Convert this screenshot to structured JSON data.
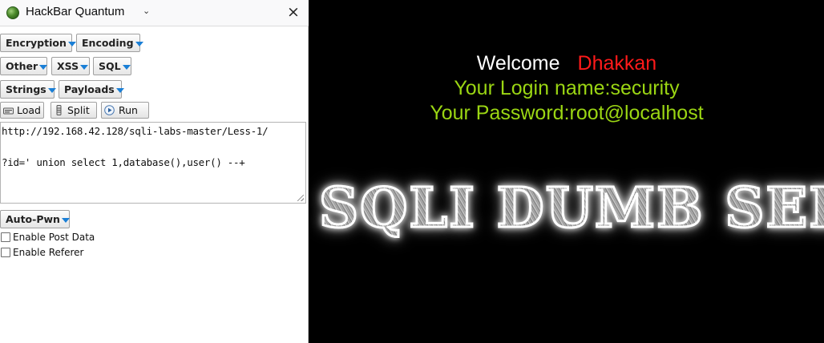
{
  "hackbar": {
    "title": "HackBar Quantum",
    "title_icon": "chevron-down-icon",
    "close": "×",
    "menus": {
      "encryption": "Encryption",
      "encoding": "Encoding",
      "other": "Other",
      "xss": "XSS",
      "sql": "SQL",
      "strings": "Strings",
      "payloads": "Payloads",
      "auto_pwn": "Auto-Pwn"
    },
    "toolbar": {
      "load": "Load",
      "split": "Split",
      "run": "Run"
    },
    "url_field": {
      "line1": "http://192.168.42.128/sqli-labs-master/Less-1/",
      "line2": "?id=' union select 1,database(),user() --+"
    },
    "checkboxes": {
      "post_data": "Enable Post Data",
      "referer": "Enable Referer"
    },
    "accent_color": "#1a7fd6"
  },
  "page": {
    "welcome": "Welcome",
    "name": "Dhakkan",
    "login": "Your Login name:security",
    "password": "Your Password:root@localhost",
    "banner": "SQLI DUMB SERIES",
    "colors": {
      "welcome": "#ffffff",
      "name": "#ff1a1a",
      "info": "#9bd613",
      "background": "#000000"
    }
  }
}
